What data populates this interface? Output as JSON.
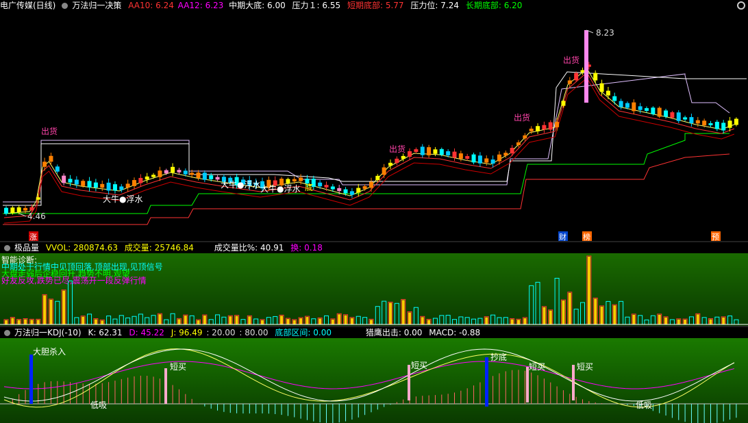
{
  "main": {
    "stock_name": "电广传媒(日线)",
    "indicator_name": "万法归一决策",
    "aa10_label": "AA10:",
    "aa10_value": "6.24",
    "aa12_label": "AA12:",
    "aa12_value": "6.23",
    "mid_bottom_label": "中期大底:",
    "mid_bottom_value": "6.00",
    "pressure1_label": "压力１:",
    "pressure1_value": "6.55",
    "short_bottom_label": "短期底部:",
    "short_bottom_value": "5.77",
    "pressure_level_label": "压力位:",
    "pressure_level_value": "7.24",
    "long_bottom_label": "长期底部:",
    "long_bottom_value": "6.20",
    "high_mark": "8.23",
    "low_mark": "4.46",
    "sell_labels": [
      "出货",
      "出货",
      "出货",
      "出货"
    ],
    "annotations": [
      "大牛●浮水",
      "大牛●浮水",
      "大牛●浮水",
      "底"
    ],
    "bottom_badges": [
      "涨",
      "财",
      "榜",
      "预"
    ]
  },
  "volume": {
    "indicator_name": "极品量",
    "vvol_label": "VVOL:",
    "vvol_value": "280874.63",
    "volume_label": "成交量:",
    "volume_value": "25746.84",
    "ratio_label": "成交量比%:",
    "ratio_value": "40.91",
    "turnover_label": "换:",
    "turnover_value": "0.18",
    "diagnosis_title": "智能诊断:",
    "diagnosis_lines": [
      "中期处于行情中见顶回落,顶部出现,见顶信号",
      "大盘走弱后企稳回升,趋势不明,观望",
      "好友反攻,跌势已尽,震荡开一段反弹行情"
    ]
  },
  "kdj": {
    "indicator_name": "万法归一KDJ(-10)",
    "k_label": "K:",
    "k_value": "62.31",
    "d_label": "D:",
    "d_value": "45.22",
    "j_label": "J:",
    "j_value": "96.49",
    "level1": ": 20.00",
    "level2": ": 80.00",
    "bottom_zone_label": "底部区间:",
    "bottom_zone_value": "0.00",
    "eagle_label": "猎鹰出击:",
    "eagle_value": "0.00",
    "macd_label": "MACD:",
    "macd_value": "-0.88",
    "signals": [
      "大胆杀入",
      "低吸",
      "短买",
      "短买",
      "抄底",
      "短买",
      "短买",
      "低吸"
    ]
  },
  "colors": {
    "up": "#ff3333",
    "down": "#00ffff",
    "yellow": "#ffff00",
    "magenta": "#ff00ff",
    "green": "#00ff00",
    "white": "#ffffff",
    "pink": "#ff88cc",
    "orange": "#ff8000"
  }
}
